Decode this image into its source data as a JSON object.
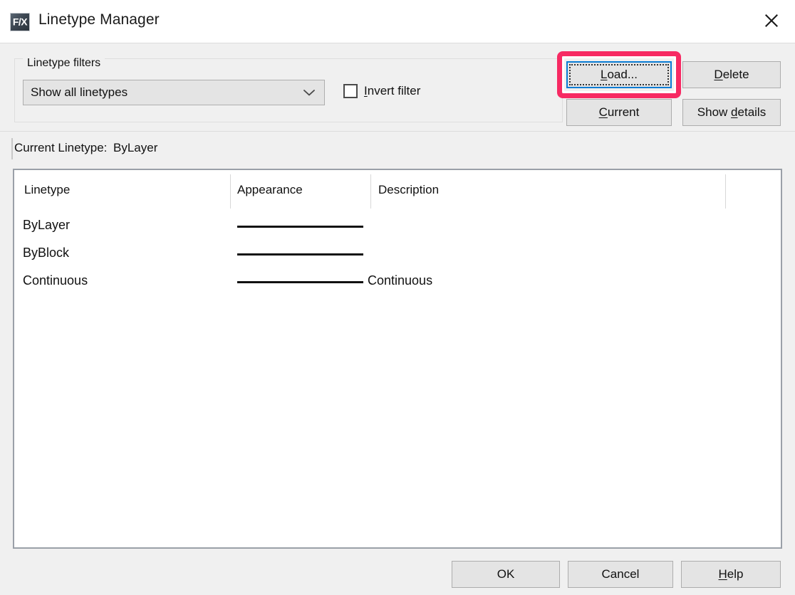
{
  "window": {
    "title": "Linetype Manager",
    "icon": "fx-logo-icon",
    "icon_text": "F/X",
    "close_icon": "close-icon"
  },
  "filters": {
    "legend": "Linetype filters",
    "select": {
      "value": "Show all linetypes",
      "arrow_icon": "chevron-down-icon"
    },
    "invert": {
      "label_prefix": "",
      "label_accel": "I",
      "label_rest": "nvert filter",
      "checked": false
    }
  },
  "actions": {
    "load": {
      "accel": "L",
      "rest": "oad...",
      "focused": true
    },
    "delete": {
      "prefix": "",
      "accel": "D",
      "rest": "elete"
    },
    "current": {
      "accel": "C",
      "rest": "urrent"
    },
    "show_details": {
      "prefix": "Show ",
      "accel": "d",
      "rest": "etails"
    }
  },
  "highlight": {
    "target": "load-button",
    "color": "#f72a63",
    "focus_color": "#0a7cd4"
  },
  "current_linetype": {
    "label": "Current Linetype:",
    "value": "ByLayer"
  },
  "list": {
    "columns": [
      "Linetype",
      "Appearance",
      "Description"
    ],
    "rows": [
      {
        "name": "ByLayer",
        "appearance": "solid-line",
        "description": ""
      },
      {
        "name": "ByBlock",
        "appearance": "solid-line",
        "description": ""
      },
      {
        "name": "Continuous",
        "appearance": "solid-line",
        "description": "Continuous"
      }
    ]
  },
  "footer": {
    "ok": "OK",
    "cancel": "Cancel",
    "help": {
      "accel": "H",
      "rest": "elp"
    }
  }
}
